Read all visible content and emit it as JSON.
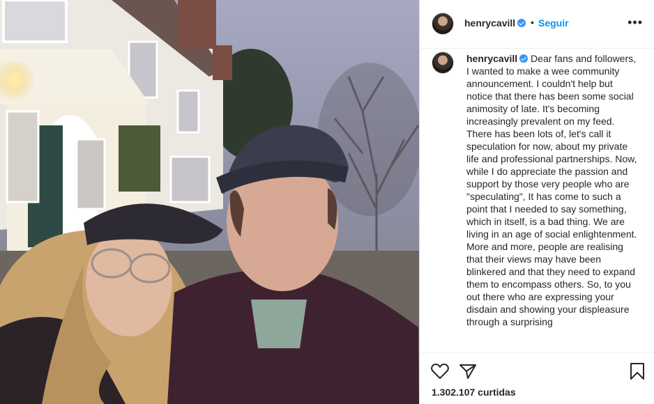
{
  "post": {
    "username": "henrycavill",
    "separator": "•",
    "follow_label": "Seguir",
    "more_label": "•••",
    "caption": "Dear fans and followers, I wanted to make a wee community announcement. I couldn't help but notice that there has been some social animosity of late. It's becoming increasingly prevalent on my feed. There has been lots of, let's call it speculation for now, about my private life and professional partnerships. Now, while I do appreciate the passion and support by those very people who are \"speculating\", It has come to such a point that I needed to say something, which in itself, is a bad thing. We are living in an age of social enlightenment. More and more, people are realising that their views may have been blinkered and that they need to expand them to encompass others. So, to you out there who are expressing your disdain and showing your displeasure through a surprising",
    "likes": "1.302.107 curtidas"
  },
  "colors": {
    "accent": "#0095f6",
    "verified": "#3897f0",
    "text": "#262626",
    "border": "#dbdbdb"
  },
  "icons": [
    "heart-icon",
    "send-icon",
    "bookmark-icon",
    "verified-icon",
    "more-icon"
  ]
}
